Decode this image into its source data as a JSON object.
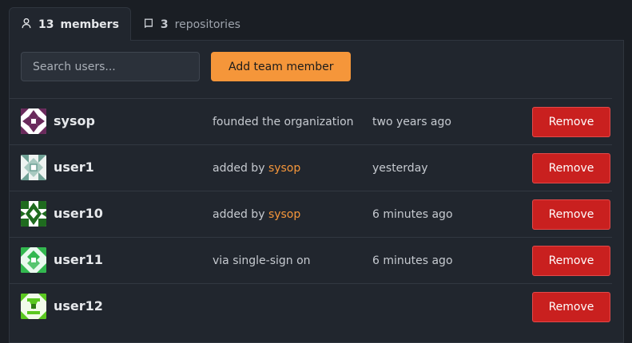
{
  "tabs": [
    {
      "count": "13",
      "label": "members",
      "icon": "person-icon",
      "active": true
    },
    {
      "count": "3",
      "label": "repositories",
      "icon": "repo-icon",
      "active": false
    }
  ],
  "toolbar": {
    "search_placeholder": "Search users...",
    "add_label": "Add team member"
  },
  "colors": {
    "accent": "#f5963a",
    "danger": "#c9201f",
    "background": "#1a1e24",
    "panel": "#21262e"
  },
  "members": [
    {
      "name": "sysop",
      "note_prefix": "founded the organization",
      "note_link": "",
      "when": "two years ago",
      "remove_label": "Remove",
      "avatar": "identicon-purple"
    },
    {
      "name": "user1",
      "note_prefix": "added by ",
      "note_link": "sysop",
      "when": "yesterday",
      "remove_label": "Remove",
      "avatar": "identicon-teal"
    },
    {
      "name": "user10",
      "note_prefix": "added by ",
      "note_link": "sysop",
      "when": "6 minutes ago",
      "remove_label": "Remove",
      "avatar": "identicon-darkgreen"
    },
    {
      "name": "user11",
      "note_prefix": "via single-sign on",
      "note_link": "",
      "when": "6 minutes ago",
      "remove_label": "Remove",
      "avatar": "identicon-green"
    },
    {
      "name": "user12",
      "note_prefix": "",
      "note_link": "",
      "when": "",
      "remove_label": "Remove",
      "avatar": "identicon-lime"
    }
  ]
}
